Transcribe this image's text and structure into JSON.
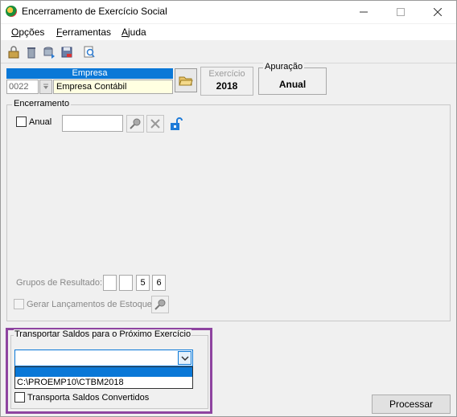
{
  "window": {
    "title": "Encerramento de Exercício Social"
  },
  "menu": [
    {
      "label": "Opções",
      "accel": "O"
    },
    {
      "label": "Ferramentas",
      "accel": "F"
    },
    {
      "label": "Ajuda",
      "accel": "A"
    }
  ],
  "toolbar": [
    "lock-icon",
    "delete-icon",
    "database-icon",
    "save-icon",
    "preview-icon"
  ],
  "empresa": {
    "label": "Empresa",
    "code": "0022",
    "name": "Empresa Contábil"
  },
  "exercicio": {
    "label": "Exercício",
    "value": "2018"
  },
  "apuracao": {
    "label": "Apuração",
    "value": "Anual"
  },
  "encerramento": {
    "label": "Encerramento",
    "anual_label": "Anual",
    "grupos_label": "Grupos de Resultado:",
    "grupos": [
      "",
      "",
      "5",
      "6"
    ],
    "estoque_label": "Gerar Lançamentos de Estoque"
  },
  "transportar": {
    "label": "Transportar Saldos para o Próximo Exercício",
    "combo_value": "",
    "options": [
      "",
      "C:\\PROEMP10\\CTBM2018"
    ],
    "convertidos_label": "Transporta Saldos Convertidos"
  },
  "processar_label": "Processar",
  "colors": {
    "accent": "#0a78d7",
    "highlight": "#8e44a0",
    "input_yellow": "#ffffe1"
  }
}
